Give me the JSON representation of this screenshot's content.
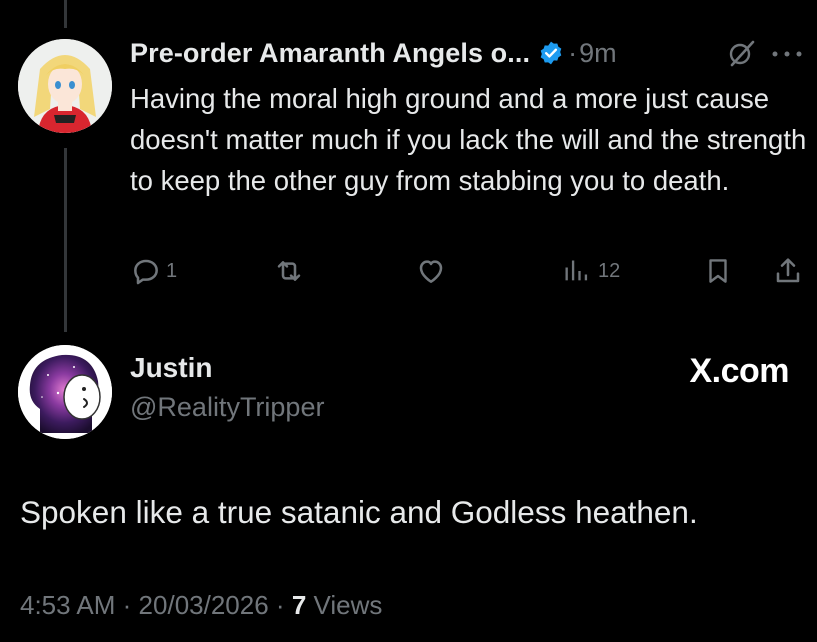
{
  "parent_tweet": {
    "author_name": "Pre-order Amaranth Angels o...",
    "separator": "·",
    "time": "9m",
    "body": "Having the moral high ground and a more just cause doesn't matter much if you lack the will and the strength to keep the other guy from stabbing you to death.",
    "actions": {
      "reply_count": "1",
      "views_count": "12"
    },
    "icons": [
      "verified-badge-icon",
      "grok-icon",
      "more-icon",
      "reply-icon",
      "retweet-icon",
      "like-icon",
      "views-icon",
      "bookmark-icon",
      "share-icon"
    ]
  },
  "reply_tweet": {
    "author_name": "Justin",
    "handle": "@RealityTripper",
    "source_label": "X.com",
    "body": "Spoken like a true satanic and Godless heathen.",
    "time": "4:53 AM",
    "date": "20/03/2026",
    "views_count": "7",
    "views_label": "Views",
    "separator": "·"
  },
  "colors": {
    "background": "#000000",
    "text": "#e7e9ea",
    "muted": "#71767b",
    "verified": "#1d9bf0",
    "thread_line": "#333639"
  }
}
